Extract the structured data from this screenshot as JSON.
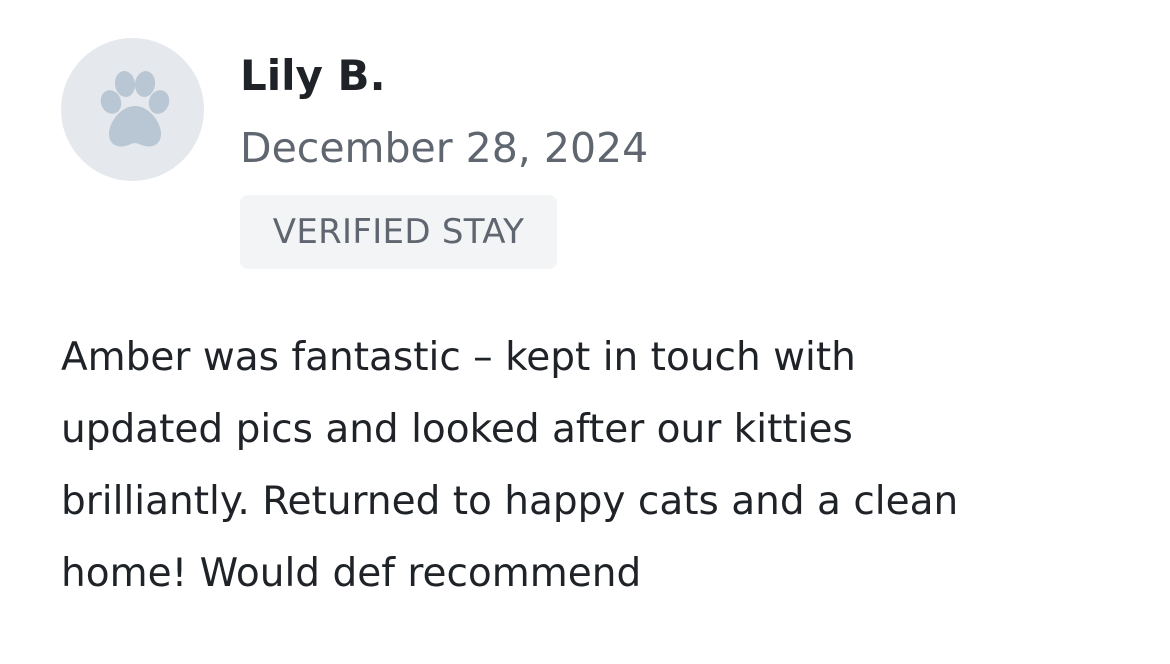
{
  "review": {
    "avatar_icon": "paw-icon",
    "avatar_colors": {
      "background": "#e5e8ec",
      "paw": "#b9c6d3"
    },
    "reviewer_name": "Lily B.",
    "date": "December 28, 2024",
    "badge": "VERIFIED STAY",
    "body_lines": [
      "Amber was fantastic – kept in touch with",
      "updated pics and looked after our kitties",
      "brilliantly. Returned to happy cats and a clean",
      "home! Would def recommend"
    ]
  }
}
